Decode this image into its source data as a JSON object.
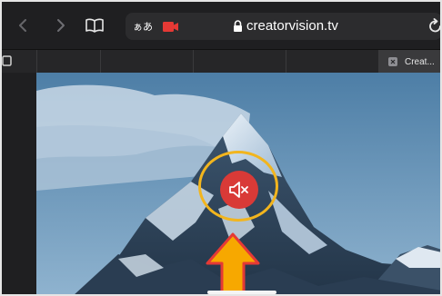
{
  "browser": {
    "address_bar": {
      "text_size_label": "ぁあ",
      "url": "creatorvision.tv"
    },
    "active_tab": {
      "title": "Creat..."
    }
  },
  "icons": {
    "back": "chevron-left-icon",
    "forward": "chevron-right-icon",
    "reader": "book-icon",
    "camera": "video-camera-icon",
    "lock": "lock-icon",
    "reload": "reload-icon",
    "tab_overview": "tab-overview-icon",
    "tab_close": "tab-close-icon",
    "mute": "speaker-muted-icon"
  },
  "colors": {
    "mute_button": "#d93a37",
    "highlight_ring": "#f2b51e",
    "pointer_arrow": "#f7a800"
  }
}
